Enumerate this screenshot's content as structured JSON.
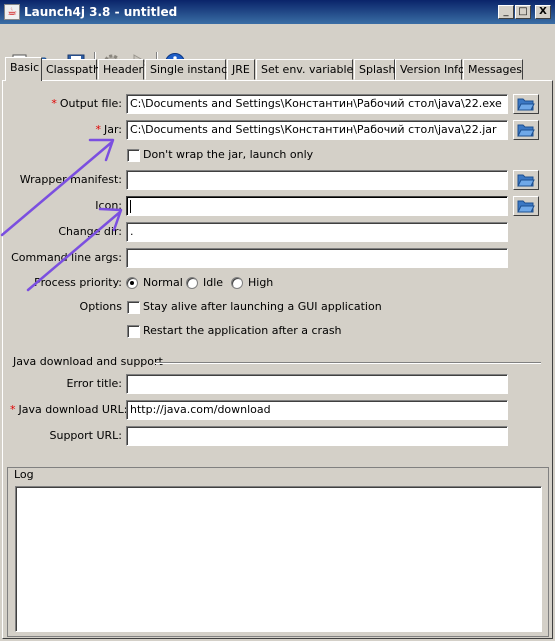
{
  "window": {
    "title": "Launch4j 3.8 - untitled",
    "controls": {
      "minimize": "_",
      "maximize": "□",
      "close": "X"
    }
  },
  "toolbar": {
    "buttons": [
      "new-config-icon",
      "open-folder-icon",
      "save-disk-icon",
      "gear-build-icon",
      "run-play-icon",
      "info-icon"
    ]
  },
  "tabs": [
    "Basic",
    "Classpath",
    "Header",
    "Single instance",
    "JRE",
    "Set env. variables",
    "Splash",
    "Version Info",
    "Messages"
  ],
  "basic": {
    "output_file": {
      "label": "Output file:",
      "required": "*",
      "value": "C:\\Documents and Settings\\Константин\\Рабочий стол\\java\\22.exe"
    },
    "jar": {
      "label": "Jar:",
      "required": "*",
      "value": "C:\\Documents and Settings\\Константин\\Рабочий стол\\java\\22.jar"
    },
    "dont_wrap": {
      "label": "Don't wrap the jar, launch only",
      "checked": false
    },
    "wrapper_manifest": {
      "label": "Wrapper manifest:",
      "value": ""
    },
    "icon": {
      "label": "Icon:",
      "value": ""
    },
    "change_dir": {
      "label": "Change dir:",
      "value": "."
    },
    "cmd_args": {
      "label": "Command line args:",
      "value": ""
    },
    "priority": {
      "label": "Process priority:",
      "options": [
        "Normal",
        "Idle",
        "High"
      ],
      "selected": "Normal"
    },
    "options": {
      "label": "Options",
      "stay_alive": "Stay alive after launching a GUI application",
      "restart": "Restart the application after a crash"
    }
  },
  "java_download": {
    "group_title": "Java download and support",
    "error_title": {
      "label": "Error title:",
      "value": ""
    },
    "download_url": {
      "label": "Java download URL:",
      "required": "*",
      "value": "http://java.com/download"
    },
    "support_url": {
      "label": "Support URL:",
      "value": ""
    }
  },
  "log": {
    "title": "Log"
  },
  "colors": {
    "titlebar": "#0a246a",
    "required": "#e00000",
    "annotation_arrow": "#7b4fe0",
    "face": "#d4d0c8"
  }
}
